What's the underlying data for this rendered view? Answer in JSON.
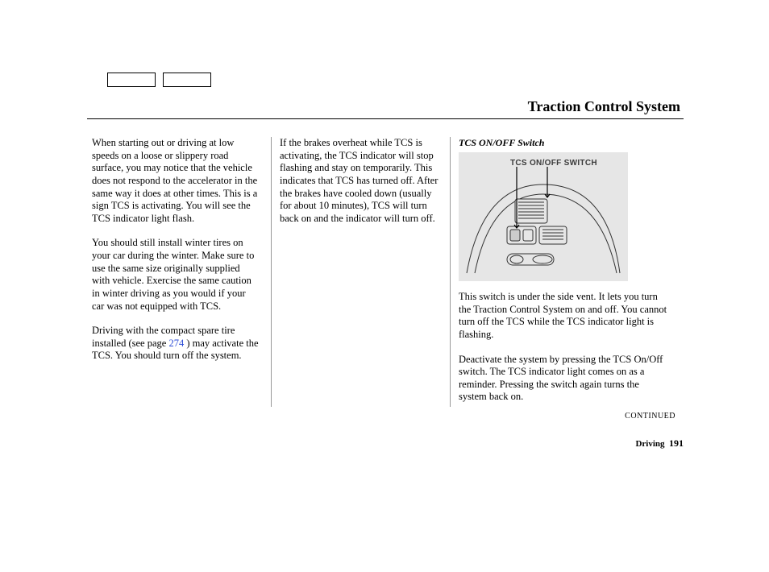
{
  "header": {
    "title": "Traction Control System"
  },
  "col1": {
    "p1": "When starting out or driving at low speeds on a loose or slippery road surface, you may notice that the vehicle does not respond to the accelerator in the same way it does at other times. This is a sign TCS is activating. You will see the TCS indicator light flash.",
    "p2": "You should still install winter tires on your car during the winter. Make sure to use the same size originally supplied with vehicle. Exercise the same caution in winter driving as you would if your car was not equipped with TCS.",
    "p3a": "Driving with the compact spare tire installed (see page ",
    "p3_link": "274",
    "p3b": " ) may activate the TCS. You should turn off the system."
  },
  "col2": {
    "p1": "If the brakes overheat while TCS is activating, the TCS indicator will stop flashing and stay on temporarily. This indicates that TCS has turned off. After the brakes have cooled down (usually for about 10 minutes), TCS will turn back on and the indicator will turn off."
  },
  "col3": {
    "subhead": "TCS ON/OFF Switch",
    "figlabel": "TCS ON/OFF SWITCH",
    "p1": "This switch is under the side vent. It lets you turn the Traction Control System on and off. You cannot turn off the TCS while the TCS indicator light is flashing.",
    "p2": "Deactivate the system by pressing the TCS On/Off switch. The TCS indicator light comes on as a reminder. Pressing the switch again turns the system back on.",
    "continued": "CONTINUED"
  },
  "footer": {
    "section": "Driving",
    "page": "191"
  }
}
